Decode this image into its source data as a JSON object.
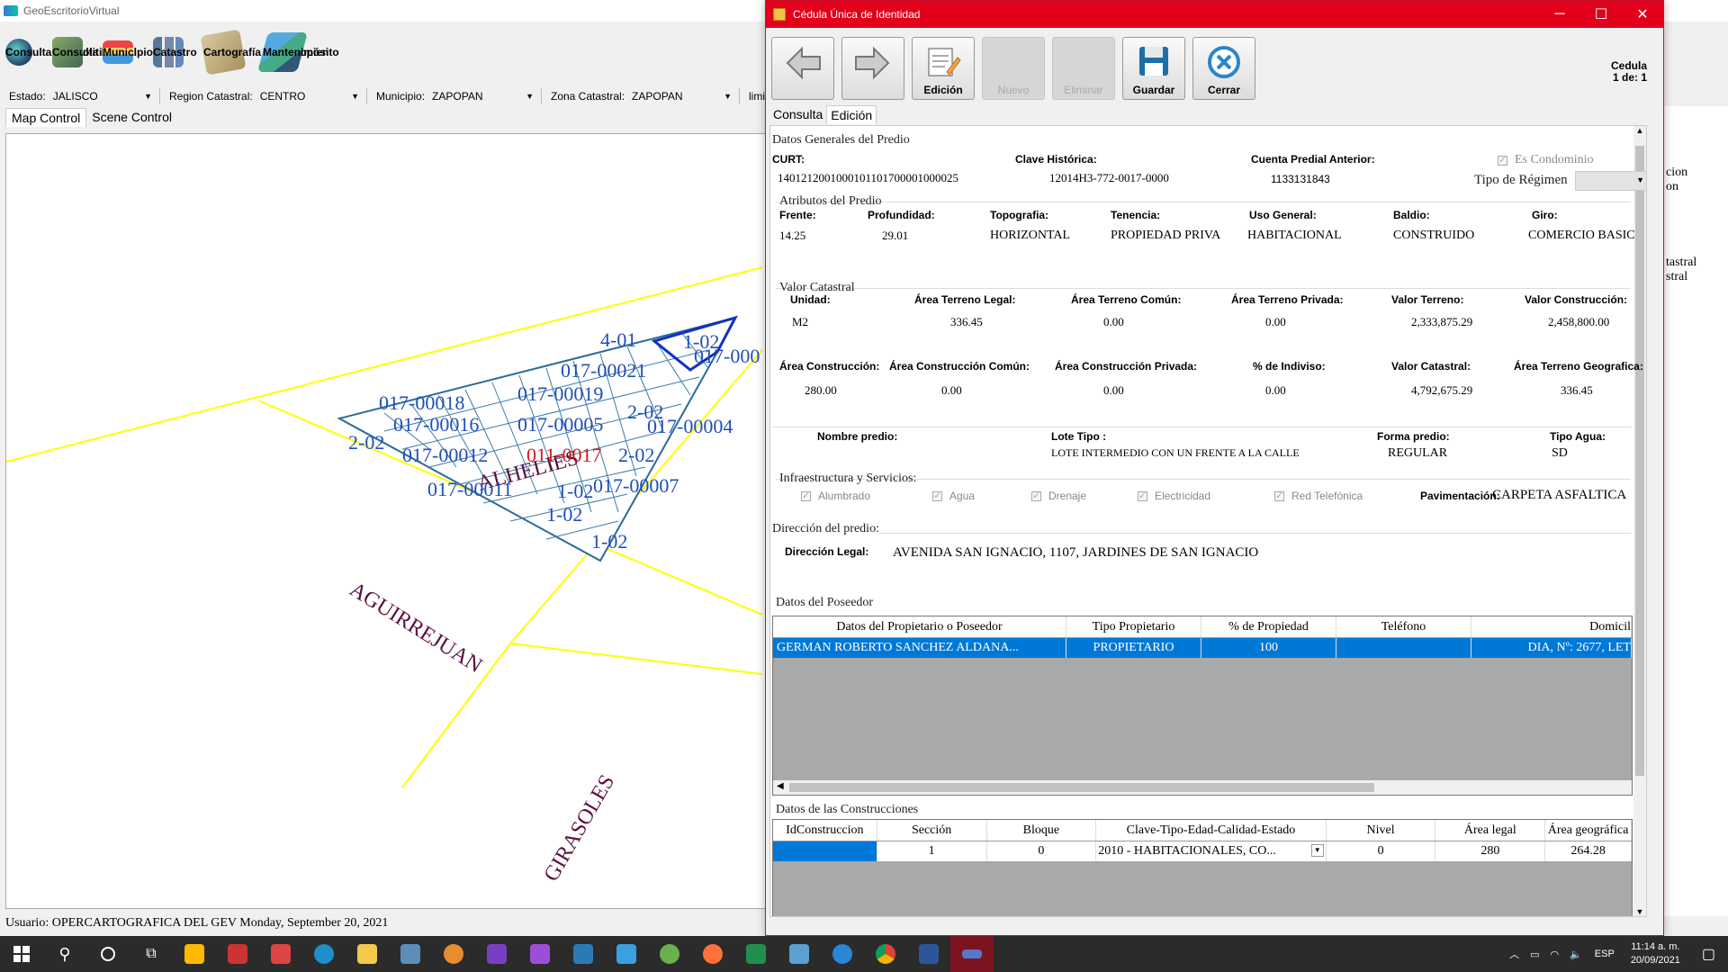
{
  "main": {
    "title": "GeoEscritorioVirtual",
    "toolbar": [
      {
        "label": "Consulta GeoPolitica",
        "icon": "globe-icon"
      },
      {
        "label": "Consulta Estatal",
        "icon": "map-icon"
      },
      {
        "label": "Municipio",
        "icon": "landscape-icon"
      },
      {
        "label": "Catastro",
        "icon": "buildings-icon"
      },
      {
        "label": "Cartografia Multiproposito",
        "label_display": "Cartografía Multipropósito",
        "icon": "scroll-map-icon"
      },
      {
        "label": "Mantenimien",
        "icon": "maintenance-icon"
      }
    ],
    "filters": [
      {
        "label": "Estado:",
        "value": "JALISCO"
      },
      {
        "label": "Region Catastral:",
        "value": "CENTRO"
      },
      {
        "label": "Municipio:",
        "value": "ZAPOPAN"
      },
      {
        "label": "Zona Catastral:",
        "value": "ZAPOPAN"
      },
      {
        "label": "limite",
        "value": ""
      }
    ],
    "tabs": [
      "Map Control",
      "Scene Control"
    ],
    "status": "Usuario: OPERCARTOGRAFICA DEL GEV  Monday, September 20, 2021",
    "right_panel": [
      "cion",
      "on",
      "tastral",
      "stral"
    ]
  },
  "map": {
    "streets": [
      "ALHELIES",
      "AGUIRREJUAN",
      "GIRASOLES"
    ],
    "labels_blue": [
      "017-00018",
      "017-00016",
      "017-00019",
      "017-00005",
      "017-00012",
      "017-00011",
      "017-00021",
      "017-00004",
      "017-00007",
      "4-01",
      "1-02",
      "2-02",
      "2-02",
      "1-02",
      "1-02",
      "1-02",
      "2-02",
      "017-000"
    ],
    "label_red": "011-0017"
  },
  "dialog": {
    "title": "Cédula Única de Identidad",
    "buttons": [
      {
        "label": "",
        "icon": "back-arrow-icon",
        "enabled": true
      },
      {
        "label": "",
        "icon": "forward-arrow-icon",
        "enabled": true
      },
      {
        "label": "Edición",
        "icon": "edit-icon",
        "enabled": true
      },
      {
        "label": "Nuevo",
        "enabled": false
      },
      {
        "label": "Eliminar",
        "enabled": false
      },
      {
        "label": "Guardar",
        "icon": "save-icon",
        "enabled": true
      },
      {
        "label": "Cerrar",
        "icon": "close-icon",
        "enabled": true
      }
    ],
    "cedula": {
      "label": "Cedula",
      "count": "1 de: 1"
    },
    "tabs": [
      "Consulta",
      "Edición"
    ],
    "generales": {
      "title": "Datos Generales del Predio",
      "curt_label": "CURT:",
      "curt": "1401212001000101101700001000025",
      "clave_label": "Clave Histórica:",
      "clave": "12014H3-772-0017-0000",
      "cuenta_label": "Cuenta Predial Anterior:",
      "cuenta": "1133131843",
      "condominio": "Es Condominio",
      "regimen_label": "Tipo de Régimen"
    },
    "atributos": {
      "title": "Atributos del Predio",
      "labels": [
        "Frente:",
        "Profundidad:",
        "Topografia:",
        "Tenencia:",
        "Uso General:",
        "Baldio:",
        "Giro:"
      ],
      "values": [
        "14.25",
        "29.01",
        "HORIZONTAL",
        "PROPIEDAD PRIVA",
        "HABITACIONAL",
        "CONSTRUIDO",
        "COMERCIO BASICO"
      ]
    },
    "valor": {
      "title": "Valor Catastral",
      "row1_labels": [
        "Unidad:",
        "Área Terreno Legal:",
        "Área Terreno Común:",
        "Área Terreno Privada:",
        "Valor  Terreno:",
        "Valor  Construcción:"
      ],
      "row1_values": [
        "M2",
        "336.45",
        "0.00",
        "0.00",
        "2,333,875.29",
        "2,458,800.00"
      ],
      "row2_labels": [
        "Área Construcción:",
        "Área Construcción Común:",
        "Área Construcción Privada:",
        "% de Indiviso:",
        "Valor Catastral:",
        "Área Terreno Geografica:"
      ],
      "row2_values": [
        "280.00",
        "0.00",
        "0.00",
        "0.00",
        "4,792,675.29",
        "336.45"
      ]
    },
    "predio": {
      "nombre_label": "Nombre predio:",
      "lote_label": "Lote Tipo :",
      "lote": "LOTE INTERMEDIO CON UN FRENTE A LA CALLE",
      "forma_label": "Forma predio:",
      "forma": "REGULAR",
      "agua_label": "Tipo Agua:",
      "agua": "SD"
    },
    "infra": {
      "title": "Infraestructura y Servicios:",
      "items": [
        "Alumbrado",
        "Agua",
        "Drenaje",
        "Electricidad",
        "Red Telefónica"
      ],
      "pav_label": "Pavimentación:",
      "pav": "CARPETA ASFALTICA"
    },
    "direccion": {
      "title": "Dirección del predio:",
      "legal_label": "Dirección Legal:",
      "legal": "AVENIDA SAN IGNACIO, 1107, JARDINES DE SAN IGNACIO"
    },
    "poseedor": {
      "title": "Datos del Poseedor",
      "headers": [
        "Datos del Propietario o Poseedor",
        "Tipo Propietario",
        "% de Propiedad",
        "Teléfono",
        "Domicil"
      ],
      "row": [
        "GERMAN ROBERTO SANCHEZ ALDANA...",
        "PROPIETARIO",
        "100",
        "",
        "DIA, Nº: 2677, LET"
      ]
    },
    "construcciones": {
      "title": "Datos de las Construcciones",
      "headers": [
        "IdConstruccion",
        "Sección",
        "Bloque",
        "Clave-Tipo-Edad-Calidad-Estado",
        "Nivel",
        "Área legal",
        "Área geográfica"
      ],
      "row": [
        "",
        "1",
        "0",
        "2010 - HABITACIONALES, CO...",
        "0",
        "280",
        "264.28"
      ]
    }
  },
  "taskbar": {
    "lang": "ESP",
    "time": "11:14 a. m.",
    "date": "20/09/2021"
  },
  "colors": {
    "accent": "#e2001a",
    "selection": "#0078d7",
    "street": "#ffff00",
    "parcel": "#1f6fa0"
  }
}
